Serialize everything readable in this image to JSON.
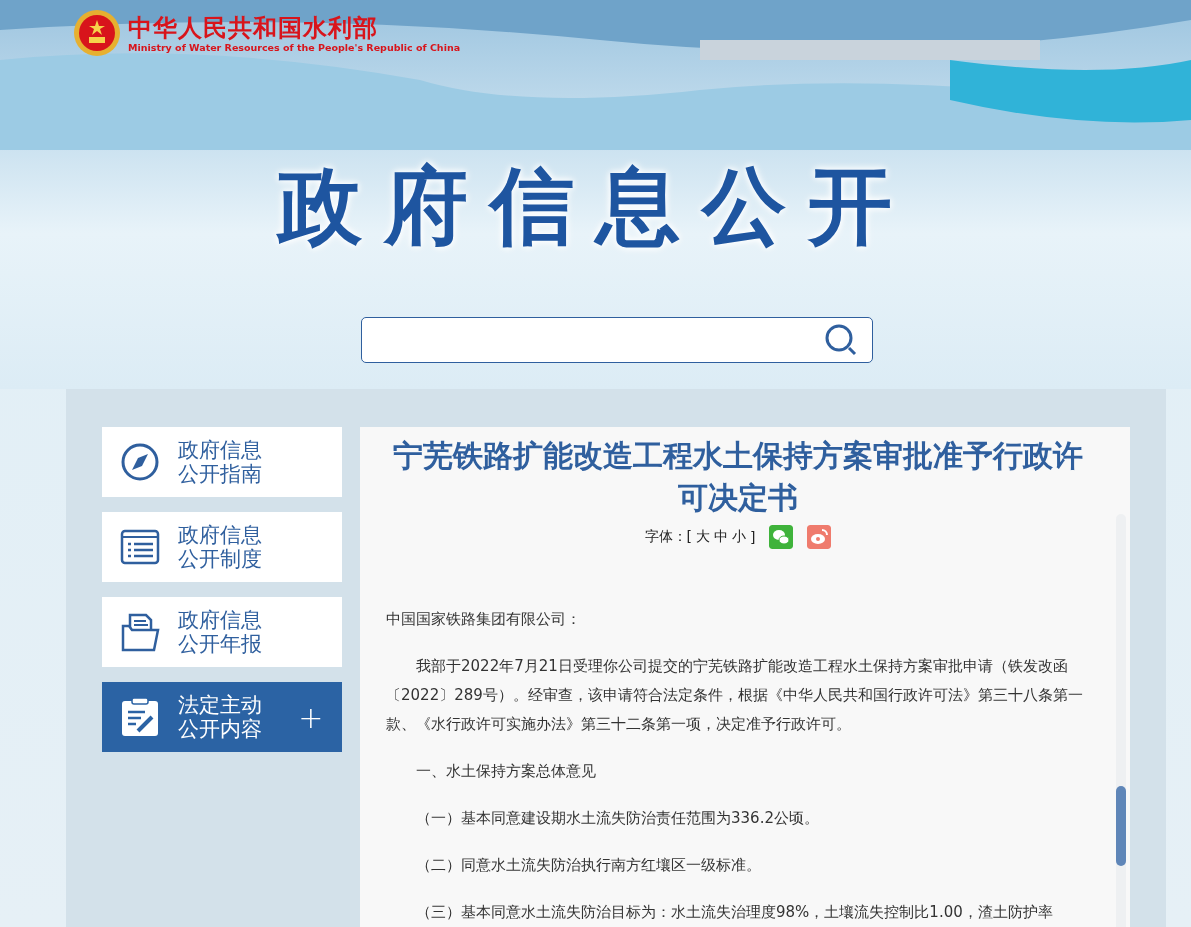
{
  "header": {
    "site_name": "中华人民共和国水利部",
    "site_name_en": "Ministry of Water Resources of the People's Republic of China",
    "banner_title": "政府信息公开"
  },
  "sidebar": {
    "items": [
      {
        "label": "政府信息公开指南",
        "selected": false
      },
      {
        "label": "政府信息公开制度",
        "selected": false
      },
      {
        "label": "政府信息公开年报",
        "selected": false
      },
      {
        "label": "法定主动公开内容",
        "selected": true,
        "expand_symbol": "+"
      }
    ]
  },
  "article": {
    "title": "宁芜铁路扩能改造工程水土保持方案审批准予行政许可决定书",
    "font_size_label": "字体：[",
    "font_sizes": [
      "大",
      "中",
      "小"
    ],
    "font_size_close": "]",
    "paragraphs": [
      {
        "kind": "salutation",
        "text": "中国国家铁路集团有限公司："
      },
      {
        "kind": "body",
        "text": "我部于2022年7月21日受理你公司提交的宁芜铁路扩能改造工程水土保持方案审批申请（铁发改函〔2022〕289号）。经审查，该申请符合法定条件，根据《中华人民共和国行政许可法》第三十八条第一款、《水行政许可实施办法》第三十二条第一项，决定准予行政许可。"
      },
      {
        "kind": "body",
        "text": "一、水土保持方案总体意见"
      },
      {
        "kind": "body",
        "text": "（一）基本同意建设期水土流失防治责任范围为336.2公顷。"
      },
      {
        "kind": "body",
        "text": "（二）同意水土流失防治执行南方红壤区一级标准。"
      },
      {
        "kind": "body",
        "text": "（三）基本同意水土流失防治目标为：水土流失治理度98%，土壤流失控制比1.00，渣土防护率"
      }
    ]
  }
}
